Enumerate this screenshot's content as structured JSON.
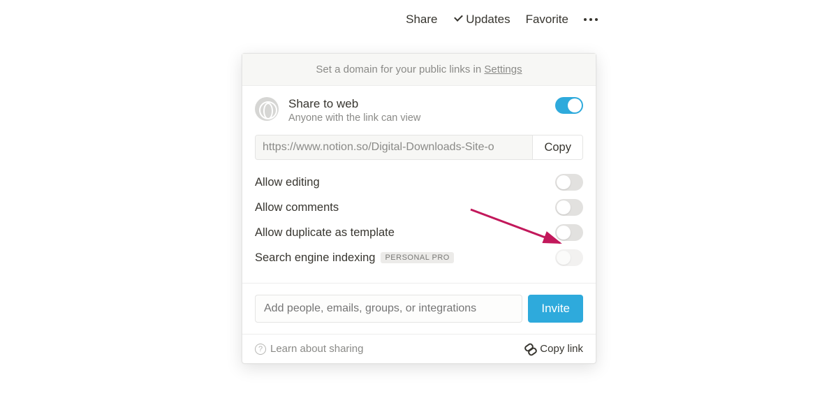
{
  "topbar": {
    "share": "Share",
    "updates": "Updates",
    "favorite": "Favorite"
  },
  "panel": {
    "banner_prefix": "Set a domain for your public links in ",
    "banner_link": "Settings",
    "share": {
      "title": "Share to web",
      "subtitle": "Anyone with the link can view",
      "enabled": true
    },
    "url": "https://www.notion.so/Digital-Downloads-Site-o",
    "copy_label": "Copy",
    "options": [
      {
        "label": "Allow editing",
        "on": false,
        "disabled": false
      },
      {
        "label": "Allow comments",
        "on": false,
        "disabled": false
      },
      {
        "label": "Allow duplicate as template",
        "on": false,
        "disabled": false
      },
      {
        "label": "Search engine indexing",
        "on": false,
        "disabled": true,
        "badge": "PERSONAL PRO"
      }
    ],
    "invite_placeholder": "Add people, emails, groups, or integrations",
    "invite_button": "Invite",
    "footer_learn": "Learn about sharing",
    "footer_copylink": "Copy link"
  },
  "colors": {
    "accent": "#2eaadc",
    "arrow": "#c2185b"
  }
}
